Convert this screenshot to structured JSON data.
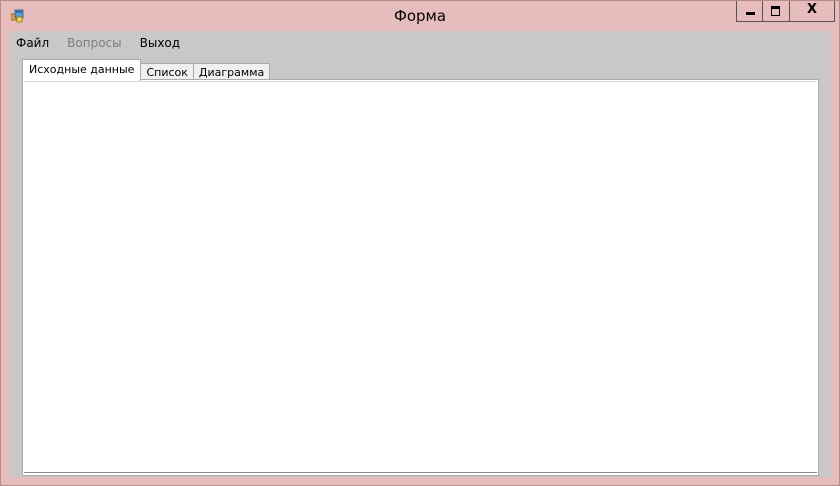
{
  "window": {
    "title": "Форма",
    "app_icon": "windows-forms-app-icon",
    "controls": {
      "minimize_icon": "minimize-icon",
      "maximize_icon": "maximize-icon",
      "close_icon": "close-icon",
      "close_glyph": "X"
    },
    "colors": {
      "frame": "#e6bcbc",
      "client": "#c8c8c8",
      "panel": "#ffffff"
    }
  },
  "menu": {
    "items": [
      {
        "label": "Файл",
        "enabled": true
      },
      {
        "label": "Вопросы",
        "enabled": false
      },
      {
        "label": "Выход",
        "enabled": true
      }
    ]
  },
  "tabs": {
    "items": [
      {
        "label": "Исходные данные",
        "active": true
      },
      {
        "label": "Список",
        "active": false
      },
      {
        "label": "Диаграмма",
        "active": false
      }
    ]
  }
}
